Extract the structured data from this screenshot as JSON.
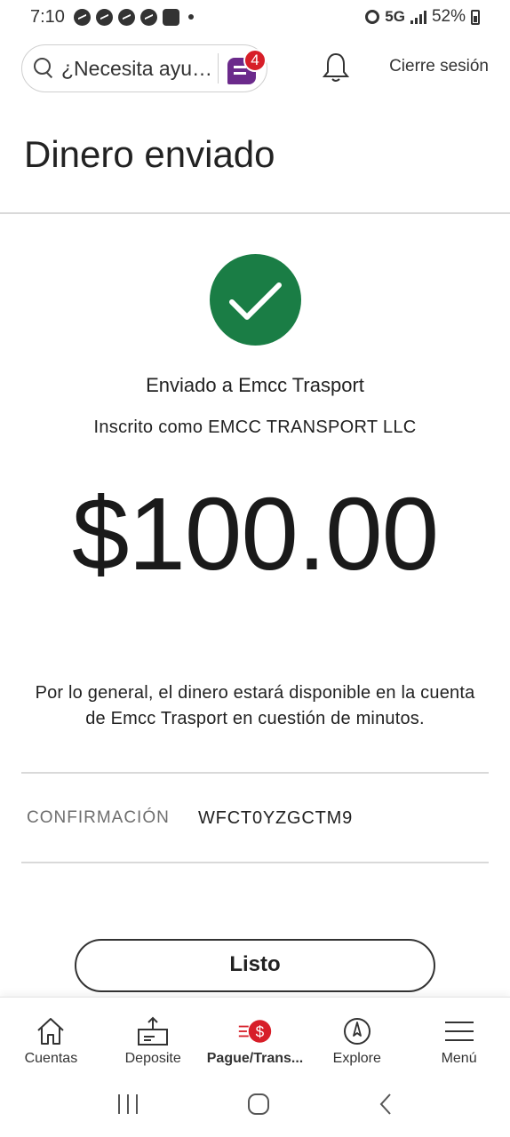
{
  "status_bar": {
    "time": "7:10",
    "network": "5G",
    "battery": "52%",
    "notification_icons": [
      "messenger-icon",
      "messenger-icon",
      "messenger-icon",
      "messenger-icon",
      "messenger-icon"
    ]
  },
  "header": {
    "search_placeholder": "¿Necesita ayu…",
    "chat_badge_count": "4",
    "logout_label": "Cierre sesión"
  },
  "page": {
    "title": "Dinero enviado",
    "sent_to": "Enviado a Emcc Trasport",
    "enrolled_as": "Inscrito como EMCC TRANSPORT LLC",
    "amount": "$100.00",
    "availability_note": "Por lo general, el dinero estará disponible en la cuenta de Emcc Trasport en cuestión de minutos.",
    "confirmation_label": "CONFIRMACIÓN",
    "confirmation_value": "WFCT0YZGCTM9",
    "done_label": "Listo"
  },
  "bottom_nav": {
    "items": [
      {
        "label": "Cuentas",
        "icon": "house-icon"
      },
      {
        "label": "Deposite",
        "icon": "deposit-icon"
      },
      {
        "label": "Pague/Trans...",
        "icon": "pay-transfer-icon",
        "active": true
      },
      {
        "label": "Explore",
        "icon": "compass-icon"
      },
      {
        "label": "Menú",
        "icon": "hamburger-icon"
      }
    ]
  },
  "colors": {
    "success_green": "#1a7d45",
    "brand_red": "#d71e28",
    "chat_purple": "#6b2a8b"
  }
}
